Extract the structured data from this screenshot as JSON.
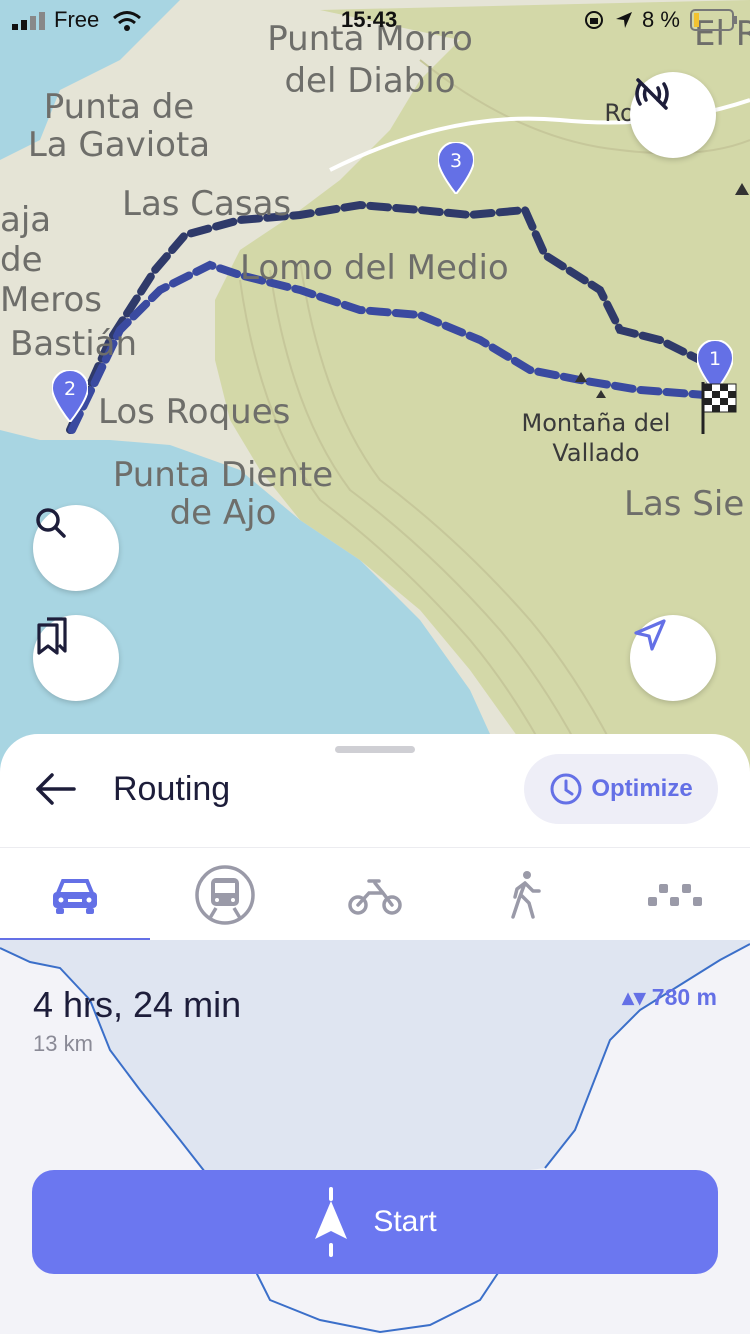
{
  "status_bar": {
    "carrier": "Free",
    "time": "15:43",
    "battery": "8 %"
  },
  "map": {
    "labels": [
      "Punta Morro del Diablo",
      "Punta de La Gaviota",
      "Las Casas",
      "aja de Meros",
      "Lomo del Medio",
      "Bastián",
      "Los Roques",
      "Punta Diente de Ajo",
      "Montaña del Vallado",
      "Las Sie",
      "Ro To",
      "El R"
    ],
    "waypoints": [
      "1",
      "2",
      "3"
    ],
    "icons": [
      "no-broadcast-icon",
      "search-icon",
      "bookmarks-icon",
      "locate-icon",
      "finish-flag-icon"
    ]
  },
  "sheet": {
    "title": "Routing",
    "optimize_label": "Optimize",
    "transport_modes": [
      "car",
      "transit",
      "bike",
      "walk",
      "more"
    ],
    "selected_mode": "car",
    "duration": "4 hrs, 24 min",
    "distance": "13 km",
    "elevation": "780 m",
    "start_label": "Start"
  },
  "colors": {
    "accent": "#6b77f0",
    "route_dark": "#2f3a6a",
    "route_blue": "#3a4aa0",
    "sea": "#a8d5e2",
    "land": "#d9dcb2"
  }
}
